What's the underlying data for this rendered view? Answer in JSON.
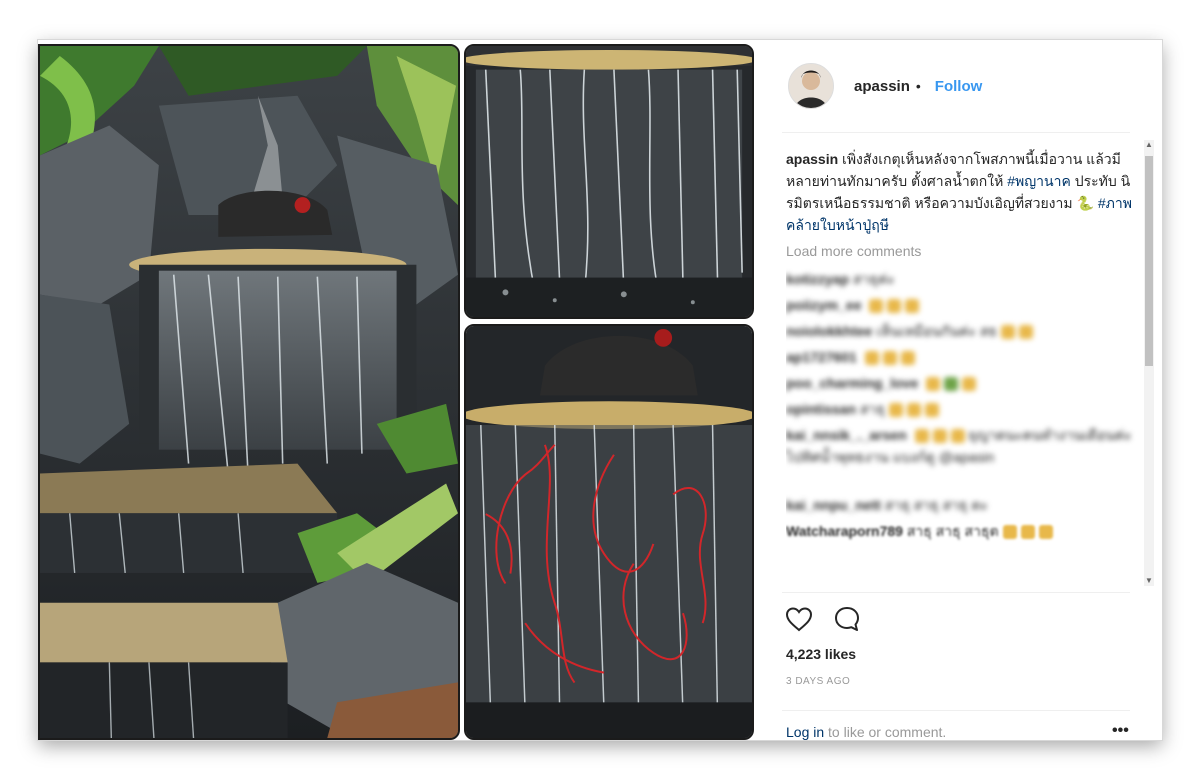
{
  "post": {
    "username": "apassin",
    "separator": "•",
    "follow_label": "Follow",
    "caption": {
      "user": "apassin",
      "text_1": " เพิ่งสังเกตุเห็นหลังจากโพสภาพนี้เมื่อวาน แล้วมีหลายท่านทักมาครับ ตั้งศาลน้ำตกให้ ",
      "tag_1": "#พญานาค",
      "text_2": " ประทับ นิรมิตรเหนือธรรมชาติ หรือความบังเอิญที่สวยงาม ",
      "emoji": "🐍",
      "tag_2": "#ภาพคล้ายใบหน้าปู่ฤษี"
    },
    "load_more": "Load more comments",
    "blurred_comments": [
      {
        "user": "kotizzyap",
        "text": "สาธุค่ะ"
      },
      {
        "user": "poiizym_ee",
        "text": ""
      },
      {
        "user": "noiolokkhtee",
        "text": "เห็นเหมือนกันค่ะ สธ"
      },
      {
        "user": "ap1727601",
        "text": ""
      },
      {
        "user": "poo_charming_love",
        "text": ""
      },
      {
        "user": "opintissan",
        "text": "สาธุ"
      },
      {
        "user": "kai_nnsik_._arsen",
        "text": "ยุญาตนะคนทำงานเดือนค่ะ ไปทิศน้ำพุทธงาน แบงก์ดู @apasin"
      },
      {
        "user": "kai_nnpu_nett",
        "text": "สาธุ สาธุ สาธุ ตะ"
      },
      {
        "user": "Watcharaporn789",
        "text": "สาธุ สาธุ สาธุต"
      }
    ],
    "likes": "4,223 likes",
    "time": "3 DAYS AGO",
    "login_prompt_link": "Log in",
    "login_prompt_rest": " to like or comment.",
    "more_label": "•••"
  },
  "icons": {
    "like": "heart-icon",
    "comment": "comment-icon"
  },
  "colors": {
    "link": "#003569",
    "follow": "#3897f0",
    "muted": "#999999"
  }
}
